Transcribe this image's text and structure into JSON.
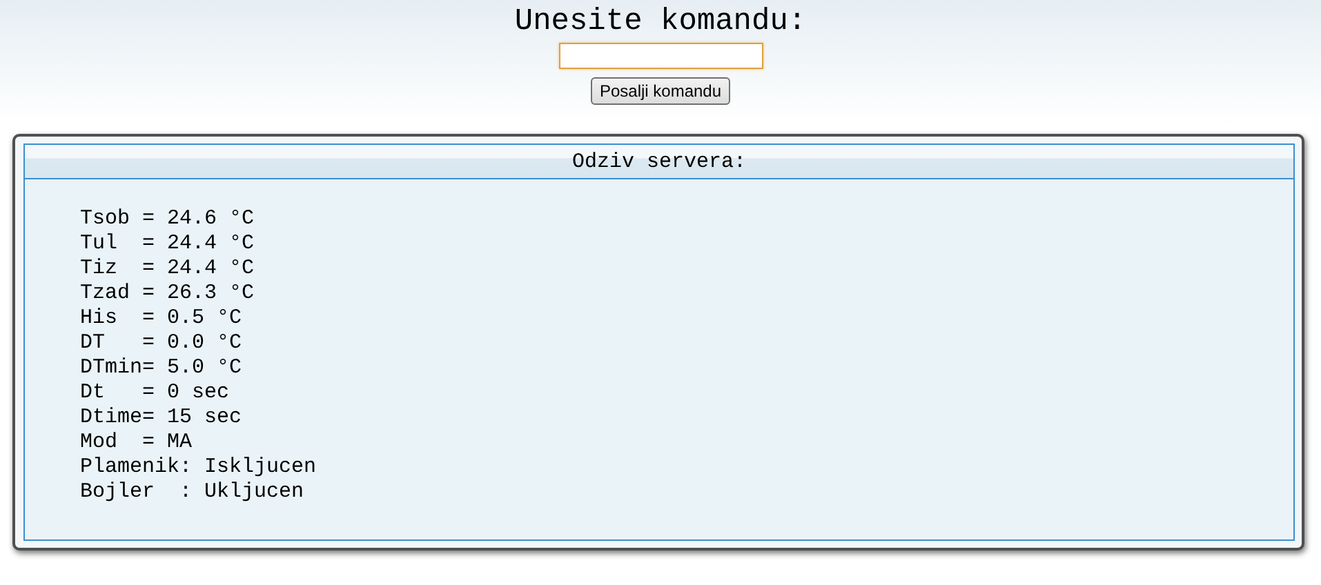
{
  "header": {
    "title": "Unesite komandu:",
    "send_button": "Posalji komandu"
  },
  "response_panel": {
    "title": "Odziv servera:",
    "lines": [
      "Tsob = 24.6 °C",
      "Tul  = 24.4 °C",
      "Tiz  = 24.4 °C",
      "Tzad = 26.3 °C",
      "His  = 0.5 °C",
      "DT   = 0.0 °C",
      "DTmin= 5.0 °C",
      "Dt   = 0 sec",
      "Dtime= 15 sec",
      "Mod  = MA",
      "Plamenik: Iskljucen",
      "Bojler  : Ukljucen"
    ]
  }
}
